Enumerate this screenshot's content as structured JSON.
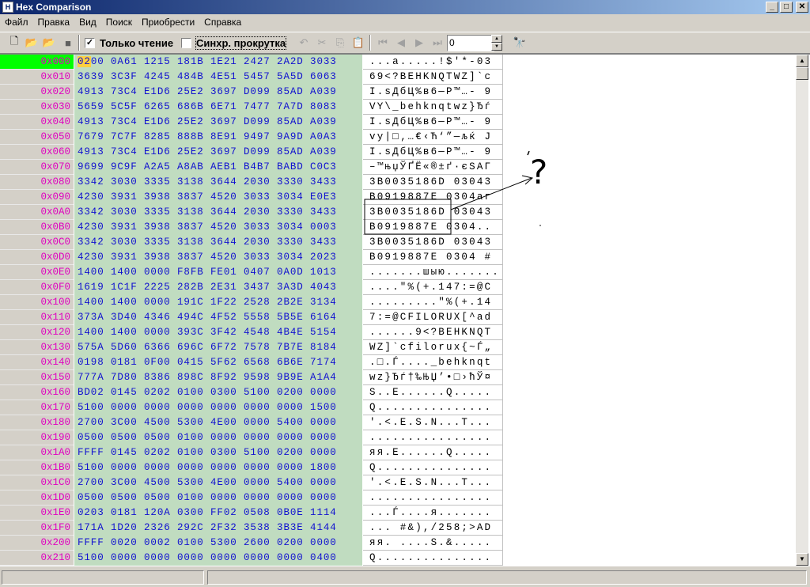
{
  "window": {
    "title": "Hex Comparison",
    "app_icon": "hex-app-icon"
  },
  "window_controls": {
    "minimize": "_",
    "maximize": "□",
    "close": "✕"
  },
  "menu": [
    "Файл",
    "Правка",
    "Вид",
    "Поиск",
    "Приобрести",
    "Справка"
  ],
  "toolbar": {
    "buttons": [
      {
        "name": "new-file",
        "glyph": "🗋",
        "enabled": true
      },
      {
        "name": "open-file",
        "glyph": "📂",
        "enabled": true
      },
      {
        "name": "open-compare",
        "glyph": "📂",
        "enabled": true
      },
      {
        "name": "stop",
        "glyph": "■",
        "enabled": true
      }
    ],
    "readonly_checkbox": {
      "label": "Только чтение",
      "checked": true
    },
    "sync_checkbox": {
      "label": "Синхр. прокрутка",
      "checked": false
    },
    "edit_buttons": [
      {
        "name": "undo",
        "glyph": "↶",
        "enabled": false
      },
      {
        "name": "cut",
        "glyph": "✂",
        "enabled": false
      },
      {
        "name": "copy",
        "glyph": "⎘",
        "enabled": false
      },
      {
        "name": "paste",
        "glyph": "📋",
        "enabled": false
      }
    ],
    "nav_buttons": [
      {
        "name": "first",
        "glyph": "⏮",
        "enabled": false
      },
      {
        "name": "prev",
        "glyph": "◀",
        "enabled": false
      },
      {
        "name": "next",
        "glyph": "▶",
        "enabled": false
      },
      {
        "name": "last",
        "glyph": "⏭",
        "enabled": false
      }
    ],
    "offset_value": "0",
    "spin_up": "▲",
    "spin_down": "▼",
    "find_glyph": "🔭"
  },
  "hex_rows": [
    {
      "addr": "0x000",
      "hex": "0200 0A61 1215 181B 1E21 2427 2A2D 3033",
      "ascii": "...a.....!$'*-03"
    },
    {
      "addr": "0x010",
      "hex": "3639 3C3F 4245 484B 4E51 5457 5A5D 6063",
      "ascii": "69<?BEHKNQTWZ]`c"
    },
    {
      "addr": "0x020",
      "hex": "4913 73C4 E1D6 25E2 3697 D099 85AD A039",
      "ascii": "I.sДбЦ%в6—Р™…- 9"
    },
    {
      "addr": "0x030",
      "hex": "5659 5C5F 6265 686B 6E71 7477 7A7D 8083",
      "ascii": "VY\\_behknqtwz}Ђѓ"
    },
    {
      "addr": "0x040",
      "hex": "4913 73C4 E1D6 25E2 3697 D099 85AD A039",
      "ascii": "I.sДбЦ%в6—Р™…- 9"
    },
    {
      "addr": "0x050",
      "hex": "7679 7C7F 8285 888B 8E91 9497 9A9D A0A3",
      "ascii": "vy|□‚…€‹Ћ‘”—љќ J"
    },
    {
      "addr": "0x060",
      "hex": "4913 73C4 E1D6 25E2 3697 D099 85AD A039",
      "ascii": "I.sДбЦ%в6—Р™…- 9"
    },
    {
      "addr": "0x070",
      "hex": "9699 9C9F A2A5 A8AB AEB1 B4B7 BABD C0C3",
      "ascii": "–™њџЎҐЁ«®±ґ·єЅАГ"
    },
    {
      "addr": "0x080",
      "hex": "3342 3030 3335 3138 3644 2030 3330 3433",
      "ascii": "3B0035186D 03043"
    },
    {
      "addr": "0x090",
      "hex": "4230 3931 3938 3837 4520 3033 3034 E0E3",
      "ascii": "B0919887E 0304аг"
    },
    {
      "addr": "0x0A0",
      "hex": "3342 3030 3335 3138 3644 2030 3330 3433",
      "ascii": "3B0035186D 03043"
    },
    {
      "addr": "0x0B0",
      "hex": "4230 3931 3938 3837 4520 3033 3034 0003",
      "ascii": "B0919887E 0304.."
    },
    {
      "addr": "0x0C0",
      "hex": "3342 3030 3335 3138 3644 2030 3330 3433",
      "ascii": "3B0035186D 03043"
    },
    {
      "addr": "0x0D0",
      "hex": "4230 3931 3938 3837 4520 3033 3034 2023",
      "ascii": "B0919887E 0304 #"
    },
    {
      "addr": "0x0E0",
      "hex": "1400 1400 0000 F8FB FE01 0407 0A0D 1013",
      "ascii": ".......шыю......."
    },
    {
      "addr": "0x0F0",
      "hex": "1619 1C1F 2225 282B 2E31 3437 3A3D 4043",
      "ascii": "....\"%(+.147:=@C"
    },
    {
      "addr": "0x100",
      "hex": "1400 1400 0000 191C 1F22 2528 2B2E 3134",
      "ascii": ".........\"%(+.14"
    },
    {
      "addr": "0x110",
      "hex": "373A 3D40 4346 494C 4F52 5558 5B5E 6164",
      "ascii": "7:=@CFILORUX[^ad"
    },
    {
      "addr": "0x120",
      "hex": "1400 1400 0000 393C 3F42 4548 4B4E 5154",
      "ascii": "......9<?BEHKNQT"
    },
    {
      "addr": "0x130",
      "hex": "575A 5D60 6366 696C 6F72 7578 7B7E 8184",
      "ascii": "WZ]`cfilorux{~Ѓ„"
    },
    {
      "addr": "0x140",
      "hex": "0198 0181 0F00 0415 5F62 6568 6B6E 7174",
      "ascii": ".□.Ѓ...._behknqt"
    },
    {
      "addr": "0x150",
      "hex": "777A 7D80 8386 898C 8F92 9598 9B9E A1A4",
      "ascii": "wz}Ђѓ†‰ЊЏ’•□›ћЎ¤"
    },
    {
      "addr": "0x160",
      "hex": "BD02 0145 0202 0100 0300 5100 0200 0000",
      "ascii": "Ѕ..E......Q....."
    },
    {
      "addr": "0x170",
      "hex": "5100 0000 0000 0000 0000 0000 0000 1500",
      "ascii": "Q..............."
    },
    {
      "addr": "0x180",
      "hex": "2700 3C00 4500 5300 4E00 0000 5400 0000",
      "ascii": "'.<.E.S.N...T..."
    },
    {
      "addr": "0x190",
      "hex": "0500 0500 0500 0100 0000 0000 0000 0000",
      "ascii": "................"
    },
    {
      "addr": "0x1A0",
      "hex": "FFFF 0145 0202 0100 0300 5100 0200 0000",
      "ascii": "яя.E......Q....."
    },
    {
      "addr": "0x1B0",
      "hex": "5100 0000 0000 0000 0000 0000 0000 1800",
      "ascii": "Q..............."
    },
    {
      "addr": "0x1C0",
      "hex": "2700 3C00 4500 5300 4E00 0000 5400 0000",
      "ascii": "'.<.E.S.N...T..."
    },
    {
      "addr": "0x1D0",
      "hex": "0500 0500 0500 0100 0000 0000 0000 0000",
      "ascii": "................"
    },
    {
      "addr": "0x1E0",
      "hex": "0203 0181 120A 0300 FF02 0508 0B0E 1114",
      "ascii": "...Ѓ....я......."
    },
    {
      "addr": "0x1F0",
      "hex": "171A 1D20 2326 292C 2F32 3538 3B3E 4144",
      "ascii": "... #&),/258;>AD"
    },
    {
      "addr": "0x200",
      "hex": "FFFF 0020 0002 0100 5300 2600 0200 0000",
      "ascii": "яя. ....S.&....."
    },
    {
      "addr": "0x210",
      "hex": "5100 0000 0000 0000 0000 0000 0000 0400",
      "ascii": "Q..............."
    }
  ],
  "cursor": {
    "row": 0,
    "text": "02"
  },
  "annotation": {
    "mark": "?"
  },
  "scrollbar": {
    "up": "▲",
    "down": "▼"
  },
  "status": {
    "panel1": "",
    "panel2": ""
  },
  "colors": {
    "addr_bg": "#d4d0c8",
    "addr_text": "#e000c0",
    "addr_selected_bg": "#00ff00",
    "hex_bg": "#c0dcc0",
    "hex_text": "#1010d0",
    "cursor_bg": "#ffd040"
  }
}
